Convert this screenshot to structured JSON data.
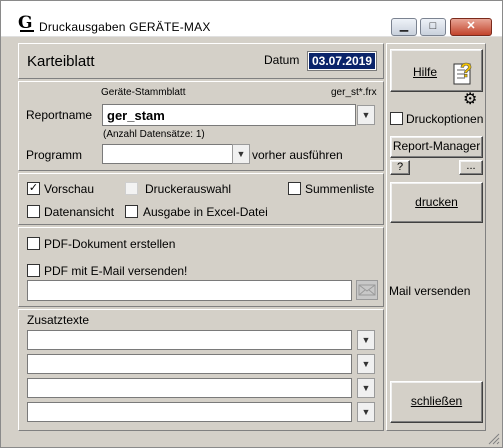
{
  "window": {
    "title": "Druckausgaben  GERÄTE-MAX",
    "controls": {
      "minimize": "▁",
      "maximize": "□",
      "close": "✕"
    }
  },
  "header": {
    "title": "Karteiblatt",
    "date_label": "Datum",
    "date_value": "03.07.2019"
  },
  "report": {
    "caption": "Geräte-Stammblatt",
    "file_pattern": "ger_st*.frx",
    "name_label": "Reportname",
    "name_value": "ger_stam",
    "record_count": "(Anzahl Datensätze: 1)",
    "program_label": "Programm",
    "program_value": "",
    "program_suffix": "vorher ausführen"
  },
  "options": {
    "preview": {
      "label": "Vorschau",
      "checked": true
    },
    "printer_select": {
      "label": "Druckerauswahl",
      "checked": false,
      "disabled": true
    },
    "totals_list": {
      "label": "Summenliste",
      "checked": false
    },
    "data_view": {
      "label": "Datenansicht",
      "checked": false
    },
    "excel_output": {
      "label": "Ausgabe in Excel-Datei",
      "checked": false
    }
  },
  "pdf": {
    "create_label": "PDF-Dokument erstellen",
    "email_label": "PDF mit E-Mail versenden!",
    "email_value": ""
  },
  "extra": {
    "label": "Zusatztexte",
    "rows": [
      "",
      "",
      "",
      ""
    ]
  },
  "side": {
    "help_label": "Hilfe",
    "print_options_label": "Druckoptionen",
    "report_manager_label": "Report-Manager",
    "question_label": "?",
    "more_label": "...",
    "print_label": "drucken",
    "mail_send_label": "Mail versenden",
    "close_label": "schließen"
  },
  "icons": {
    "app": "G",
    "checkmark": "✓",
    "dropdown": "▼",
    "gear": "⚙"
  }
}
